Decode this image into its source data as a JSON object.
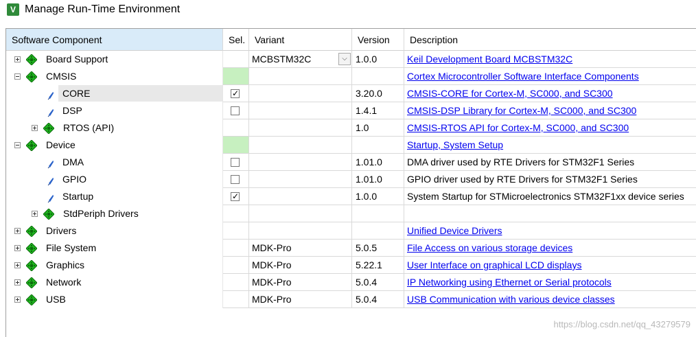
{
  "window": {
    "title": "Manage Run-Time Environment",
    "icon": "keil-v-icon",
    "icon_letter": "V"
  },
  "columns": {
    "component": "Software Component",
    "sel": "Sel.",
    "variant": "Variant",
    "version": "Version",
    "description": "Description"
  },
  "rows": [
    {
      "name": "Board Support",
      "variant": "MCBSTM32C",
      "version": "1.0.0",
      "description": "Keil Development Board MCBSTM32C",
      "link": true,
      "icon": "component-diamond-icon",
      "expander": "plus",
      "dropdown": "chevron-down-icon"
    },
    {
      "name": "CMSIS",
      "variant": "",
      "version": "",
      "description": "Cortex Microcontroller Software Interface Components",
      "link": true,
      "icon": "component-diamond-icon",
      "expander": "minus"
    },
    {
      "name": "CORE",
      "variant": "",
      "version": "3.20.0",
      "description": "CMSIS-CORE for Cortex-M, SC000, and SC300",
      "link": true,
      "icon": "pin-icon",
      "checked": true
    },
    {
      "name": "DSP",
      "variant": "",
      "version": "1.4.1",
      "description": "CMSIS-DSP Library for Cortex-M, SC000, and SC300",
      "link": true,
      "icon": "pin-icon",
      "checked": false
    },
    {
      "name": "RTOS (API)",
      "variant": "",
      "version": "1.0",
      "description": "CMSIS-RTOS API for Cortex-M, SC000, and SC300",
      "link": true,
      "icon": "component-diamond-icon",
      "expander": "plus"
    },
    {
      "name": "Device",
      "variant": "",
      "version": "",
      "description": "Startup, System Setup",
      "link": true,
      "icon": "component-diamond-icon",
      "expander": "minus"
    },
    {
      "name": "DMA",
      "variant": "",
      "version": "1.01.0",
      "description": "DMA driver used by RTE Drivers for STM32F1 Series",
      "link": false,
      "icon": "pin-icon",
      "checked": false
    },
    {
      "name": "GPIO",
      "variant": "",
      "version": "1.01.0",
      "description": "GPIO driver used by RTE Drivers for STM32F1 Series",
      "link": false,
      "icon": "pin-icon",
      "checked": false
    },
    {
      "name": "Startup",
      "variant": "",
      "version": "1.0.0",
      "description": "System Startup for STMicroelectronics STM32F1xx device series",
      "link": false,
      "icon": "pin-icon",
      "checked": true
    },
    {
      "name": "StdPeriph Drivers",
      "variant": "",
      "version": "",
      "description": "",
      "link": false,
      "icon": "component-diamond-icon",
      "expander": "plus"
    },
    {
      "name": "Drivers",
      "variant": "",
      "version": "",
      "description": "Unified Device Drivers",
      "link": true,
      "icon": "component-diamond-icon",
      "expander": "plus"
    },
    {
      "name": "File System",
      "variant": "MDK-Pro",
      "version": "5.0.5",
      "description": "File Access on various storage devices",
      "link": true,
      "icon": "component-diamond-icon",
      "expander": "plus"
    },
    {
      "name": "Graphics",
      "variant": "MDK-Pro",
      "version": "5.22.1",
      "description": "User Interface on graphical LCD displays",
      "link": true,
      "icon": "component-diamond-icon",
      "expander": "plus"
    },
    {
      "name": "Network",
      "variant": "MDK-Pro",
      "version": "5.0.4",
      "description": "IP Networking using Ethernet or Serial protocols",
      "link": true,
      "icon": "component-diamond-icon",
      "expander": "plus"
    },
    {
      "name": "USB",
      "variant": "MDK-Pro",
      "version": "5.0.4",
      "description": "USB Communication with various device classes",
      "link": true,
      "icon": "component-diamond-icon",
      "expander": "plus"
    }
  ],
  "watermark": "https://blog.csdn.net/qq_43279579",
  "colors": {
    "link": "#0000ee",
    "header_selected": "#d9ebf9",
    "required_green": "#c7f0c0",
    "diamond_green": "#1fb51f",
    "pin_blue": "#2a62c9"
  }
}
